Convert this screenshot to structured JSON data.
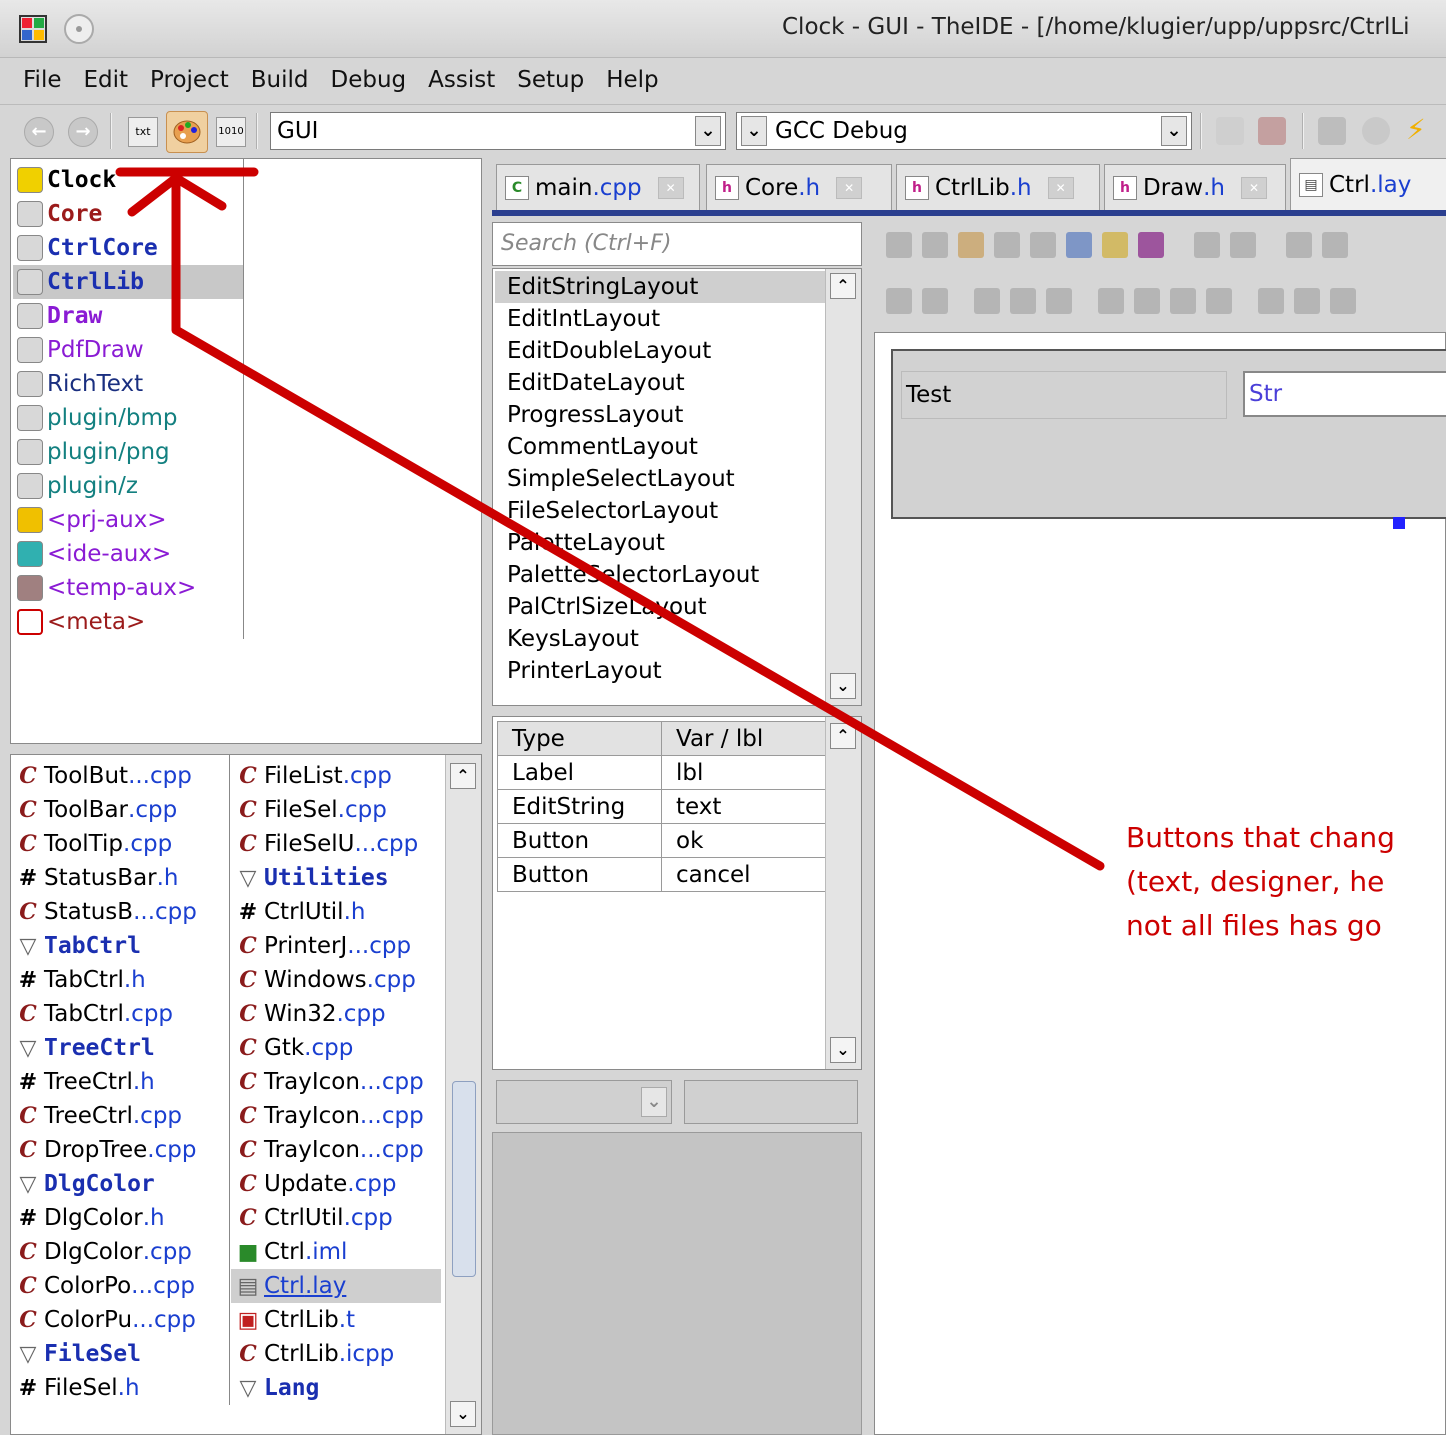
{
  "window": {
    "title": "Clock - GUI - TheIDE - [/home/klugier/upp/uppsrc/CtrlLi"
  },
  "menu": [
    "File",
    "Edit",
    "Project",
    "Build",
    "Debug",
    "Assist",
    "Setup",
    "Help"
  ],
  "toolbar": {
    "txt_label": "txt",
    "hex_label": "1010",
    "config_value": "GUI",
    "build_value": "GCC Debug"
  },
  "packages": [
    {
      "label": "Clock",
      "color": "#000000",
      "bold": true
    },
    {
      "label": "Core",
      "color": "#9b1b1b",
      "bold": true
    },
    {
      "label": "CtrlCore",
      "color": "#1a2fb0",
      "bold": true
    },
    {
      "label": "CtrlLib",
      "color": "#1a2fb0",
      "bold": true
    },
    {
      "label": "Draw",
      "color": "#8a1bd4",
      "bold": true
    },
    {
      "label": "PdfDraw",
      "color": "#8a1bd4",
      "bold": false
    },
    {
      "label": "RichText",
      "color": "#1a2f80",
      "bold": false
    },
    {
      "label": "plugin/bmp",
      "color": "#138080",
      "bold": false
    },
    {
      "label": "plugin/png",
      "color": "#138080",
      "bold": false
    },
    {
      "label": "plugin/z",
      "color": "#138080",
      "bold": false
    },
    {
      "label": "<prj-aux>",
      "color": "#8a1bd4",
      "bold": false
    },
    {
      "label": "<ide-aux>",
      "color": "#8a1bd4",
      "bold": false
    },
    {
      "label": "<temp-aux>",
      "color": "#8a1bd4",
      "bold": false
    },
    {
      "label": "<meta>",
      "color": "#9b1b1b",
      "bold": false
    }
  ],
  "files_col1": [
    {
      "icon": "cpp",
      "name": "ToolBut",
      "ext": "...cpp"
    },
    {
      "icon": "cpp",
      "name": "ToolBar",
      "ext": ".cpp"
    },
    {
      "icon": "cpp",
      "name": "ToolTip",
      "ext": ".cpp"
    },
    {
      "icon": "h",
      "name": "StatusBar",
      "ext": ".h"
    },
    {
      "icon": "cpp",
      "name": "StatusB",
      "ext": "...cpp"
    },
    {
      "icon": "sep",
      "name": "TabCtrl",
      "ext": ""
    },
    {
      "icon": "h",
      "name": "TabCtrl",
      "ext": ".h"
    },
    {
      "icon": "cpp",
      "name": "TabCtrl",
      "ext": ".cpp"
    },
    {
      "icon": "sep",
      "name": "TreeCtrl",
      "ext": ""
    },
    {
      "icon": "h",
      "name": "TreeCtrl",
      "ext": ".h"
    },
    {
      "icon": "cpp",
      "name": "TreeCtrl",
      "ext": ".cpp"
    },
    {
      "icon": "cpp",
      "name": "DropTree",
      "ext": ".cpp"
    },
    {
      "icon": "sep",
      "name": "DlgColor",
      "ext": ""
    },
    {
      "icon": "h",
      "name": "DlgColor",
      "ext": ".h"
    },
    {
      "icon": "cpp",
      "name": "DlgColor",
      "ext": ".cpp"
    },
    {
      "icon": "cpp",
      "name": "ColorPo",
      "ext": "...cpp"
    },
    {
      "icon": "cpp",
      "name": "ColorPu",
      "ext": "...cpp"
    },
    {
      "icon": "sep",
      "name": "FileSel",
      "ext": ""
    },
    {
      "icon": "h",
      "name": "FileSel",
      "ext": ".h"
    }
  ],
  "files_col2": [
    {
      "icon": "cpp",
      "name": "FileList",
      "ext": ".cpp"
    },
    {
      "icon": "cpp",
      "name": "FileSel",
      "ext": ".cpp"
    },
    {
      "icon": "cpp",
      "name": "FileSelU",
      "ext": "...cpp"
    },
    {
      "icon": "sep",
      "name": "Utilities",
      "ext": ""
    },
    {
      "icon": "h",
      "name": "CtrlUtil",
      "ext": ".h"
    },
    {
      "icon": "cpp",
      "name": "PrinterJ",
      "ext": "...cpp"
    },
    {
      "icon": "cpp",
      "name": "Windows",
      "ext": ".cpp"
    },
    {
      "icon": "cpp",
      "name": "Win32",
      "ext": ".cpp"
    },
    {
      "icon": "cpp",
      "name": "Gtk",
      "ext": ".cpp"
    },
    {
      "icon": "cpp",
      "name": "TrayIcon",
      "ext": "...cpp"
    },
    {
      "icon": "cpp",
      "name": "TrayIcon",
      "ext": "...cpp"
    },
    {
      "icon": "cpp",
      "name": "TrayIcon",
      "ext": "...cpp"
    },
    {
      "icon": "cpp",
      "name": "Update",
      "ext": ".cpp"
    },
    {
      "icon": "cpp",
      "name": "CtrlUtil",
      "ext": ".cpp"
    },
    {
      "icon": "iml",
      "name": "Ctrl",
      "ext": ".iml"
    },
    {
      "icon": "lay",
      "name": "Ctrl",
      "ext": ".lay"
    },
    {
      "icon": "t",
      "name": "CtrlLib",
      "ext": ".t"
    },
    {
      "icon": "icpp",
      "name": "CtrlLib",
      "ext": ".icpp"
    },
    {
      "icon": "sep",
      "name": "Lang",
      "ext": ""
    }
  ],
  "tabs": [
    {
      "name": "main",
      "ext": ".cpp",
      "icon": "C"
    },
    {
      "name": "Core",
      "ext": ".h",
      "icon": "h"
    },
    {
      "name": "CtrlLib",
      "ext": ".h",
      "icon": "h"
    },
    {
      "name": "Draw",
      "ext": ".h",
      "icon": "h"
    },
    {
      "name": "Ctrl",
      "ext": ".lay",
      "icon": "lay"
    }
  ],
  "layout_search": {
    "placeholder": "Search (Ctrl+F)"
  },
  "layouts": [
    "EditStringLayout",
    "EditIntLayout",
    "EditDoubleLayout",
    "EditDateLayout",
    "ProgressLayout",
    "CommentLayout",
    "SimpleSelectLayout",
    "FileSelectorLayout",
    "PaletteLayout",
    "PaletteSelectorLayout",
    "PalCtrlSizeLayout",
    "KeysLayout",
    "PrinterLayout"
  ],
  "props": {
    "headers": [
      "Type",
      "Var / lbl"
    ],
    "rows": [
      [
        "Label",
        "lbl"
      ],
      [
        "EditString",
        "text"
      ],
      [
        "Button",
        "ok"
      ],
      [
        "Button",
        "cancel"
      ]
    ]
  },
  "designer": {
    "label_text": "Test",
    "edit_text": "Str"
  },
  "annotation": {
    "line1": "Buttons that chang",
    "line2": "(text, designer, he",
    "line3": "not all files has go",
    "color": "#cc0000"
  }
}
